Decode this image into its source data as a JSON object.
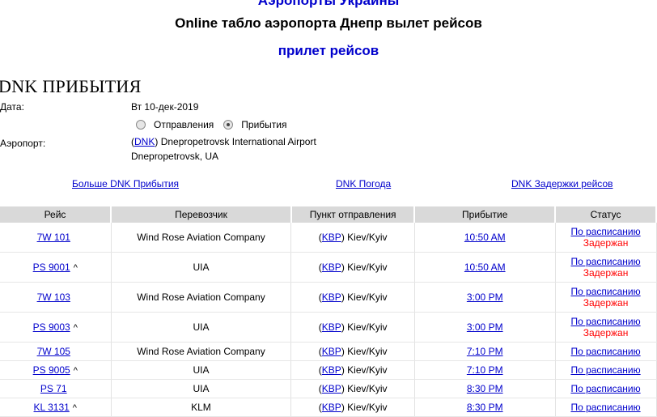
{
  "header": {
    "top_link": "Аэропорты Украины",
    "title": "Online табло аэропорта Днепр вылет рейсов",
    "arrivals_link": "прилет рейсов"
  },
  "section": {
    "title": "DNK ПРИБЫТИЯ",
    "date_label": "Дата:",
    "date_value": "Вт 10-дек-2019",
    "radio_departures": "Отправления",
    "radio_arrivals": "Прибытия",
    "airport_label": "Аэропорт:",
    "airport_code": "DNK",
    "airport_name": "Dnepropetrovsk International Airport",
    "airport_city": "Dnepropetrovsk, UA"
  },
  "links": {
    "more": "Больше DNK Прибытия",
    "weather": "DNK Погода",
    "delays": "DNK Задержки рейсов"
  },
  "table": {
    "headers": [
      "Рейс",
      "Перевозчик",
      "Пункт отправления",
      "Прибытие",
      "Статус"
    ],
    "rows": [
      {
        "flight": "7W 101",
        "caret": "",
        "carrier": "Wind Rose Aviation Company",
        "origin_code": "KBP",
        "origin_city": "Kiev/Kyiv",
        "arrival": "10:50 AM",
        "status": "По расписанию",
        "status2": "Задержан"
      },
      {
        "flight": "PS 9001",
        "caret": "^",
        "carrier": "UIA",
        "origin_code": "KBP",
        "origin_city": "Kiev/Kyiv",
        "arrival": "10:50 AM",
        "status": "По расписанию",
        "status2": "Задержан"
      },
      {
        "flight": "7W 103",
        "caret": "",
        "carrier": "Wind Rose Aviation Company",
        "origin_code": "KBP",
        "origin_city": "Kiev/Kyiv",
        "arrival": "3:00 PM",
        "status": "По расписанию",
        "status2": "Задержан"
      },
      {
        "flight": "PS 9003",
        "caret": "^",
        "carrier": "UIA",
        "origin_code": "KBP",
        "origin_city": "Kiev/Kyiv",
        "arrival": "3:00 PM",
        "status": "По расписанию",
        "status2": "Задержан"
      },
      {
        "flight": "7W 105",
        "caret": "",
        "carrier": "Wind Rose Aviation Company",
        "origin_code": "KBP",
        "origin_city": "Kiev/Kyiv",
        "arrival": "7:10 PM",
        "status": "По расписанию",
        "status2": ""
      },
      {
        "flight": "PS 9005",
        "caret": "^",
        "carrier": "UIA",
        "origin_code": "KBP",
        "origin_city": "Kiev/Kyiv",
        "arrival": "7:10 PM",
        "status": "По расписанию",
        "status2": ""
      },
      {
        "flight": "PS 71",
        "caret": "",
        "carrier": "UIA",
        "origin_code": "KBP",
        "origin_city": "Kiev/Kyiv",
        "arrival": "8:30 PM",
        "status": "По расписанию",
        "status2": ""
      },
      {
        "flight": "KL 3131",
        "caret": "^",
        "carrier": "KLM",
        "origin_code": "KBP",
        "origin_city": "Kiev/Kyiv",
        "arrival": "8:30 PM",
        "status": "По расписанию",
        "status2": ""
      }
    ]
  },
  "colors": {
    "link": "#0000cc",
    "delayed": "#ff0000",
    "header_bg": "#d9d9d9"
  }
}
